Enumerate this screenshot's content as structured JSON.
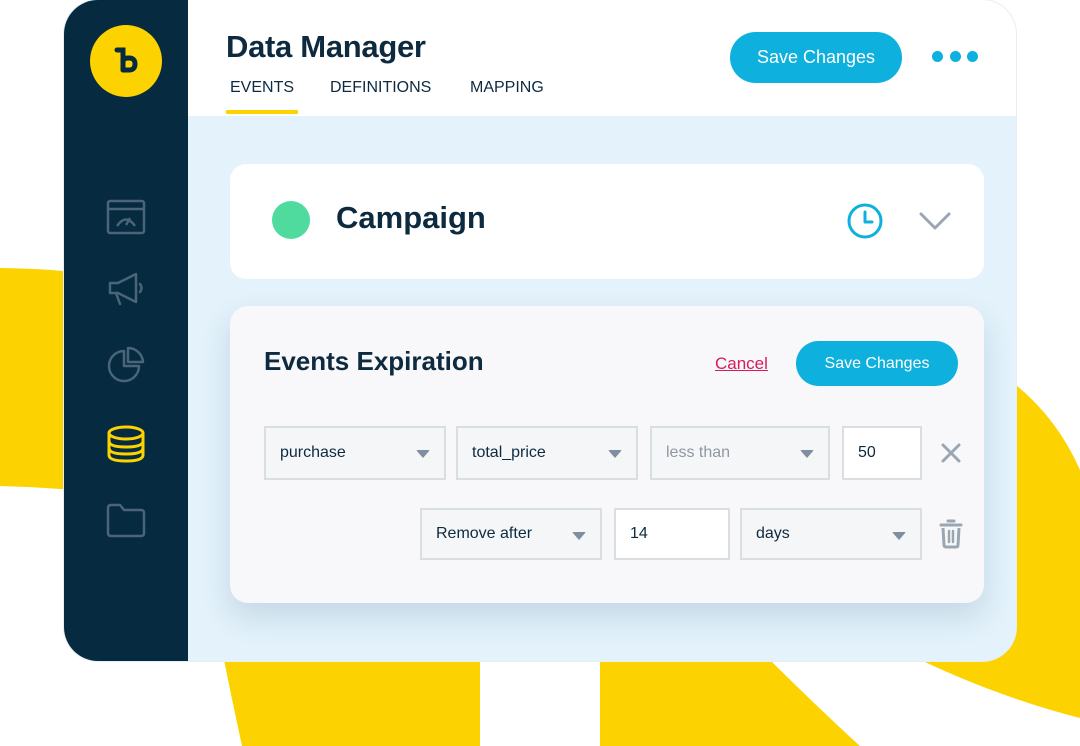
{
  "app": {
    "title": "Data Manager",
    "tabs": [
      {
        "label": "EVENTS",
        "active": true
      },
      {
        "label": "DEFINITIONS",
        "active": false
      },
      {
        "label": "MAPPING",
        "active": false
      }
    ],
    "save_label": "Save Changes",
    "more_icon": "more-dots-icon"
  },
  "sidebar": {
    "logo": "brand-logo",
    "items": [
      {
        "icon": "dashboard-icon"
      },
      {
        "icon": "megaphone-icon"
      },
      {
        "icon": "pie-chart-icon"
      },
      {
        "icon": "database-icon",
        "active": true
      },
      {
        "icon": "folder-icon"
      }
    ]
  },
  "campaign": {
    "title": "Campaign",
    "status_color": "#4fdb9e",
    "clock_icon": "clock-icon",
    "chevron_icon": "chevron-down-icon"
  },
  "expiration": {
    "title": "Events Expiration",
    "cancel_label": "Cancel",
    "save_label": "Save Changes",
    "rule": {
      "event": "purchase",
      "property": "total_price",
      "operator_placeholder": "less than",
      "value": "50"
    },
    "action": {
      "mode": "Remove after",
      "amount": "14",
      "unit": "days"
    }
  },
  "colors": {
    "accent": "#0eb0dd",
    "brand_yellow": "#fcd300",
    "sidebar_bg": "#062a40",
    "danger": "#d61c5c",
    "content_bg": "#e3f2fb"
  }
}
